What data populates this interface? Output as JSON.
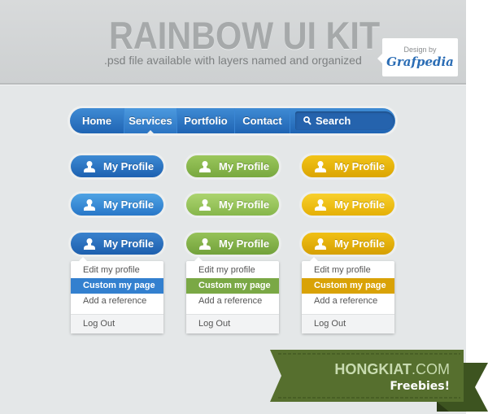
{
  "header": {
    "title": "RAINBOW UI KIT",
    "subtitle": ".psd file available with layers named and organized",
    "badge_by": "Design by",
    "badge_brand": "Grafpedia"
  },
  "nav": {
    "items": [
      {
        "label": "Home",
        "active": false
      },
      {
        "label": "Services",
        "active": true
      },
      {
        "label": "Portfolio",
        "active": false
      },
      {
        "label": "Contact",
        "active": false
      }
    ],
    "search_label": "Search",
    "search_icon": "search-icon"
  },
  "colors": {
    "blue": "#2a72c2",
    "green": "#82b04a",
    "yellow": "#e2ac06",
    "blue_sel": "#3380cf",
    "green_sel": "#7aa845",
    "yellow_sel": "#d9a207",
    "ribbon": "#4f6b2c"
  },
  "profile_button": {
    "label": "My Profile",
    "icon": "user-icon"
  },
  "columns": [
    {
      "name": "blue",
      "states": [
        "normal",
        "hover",
        "pressed"
      ]
    },
    {
      "name": "green",
      "states": [
        "normal",
        "hover",
        "pressed"
      ]
    },
    {
      "name": "yellow",
      "states": [
        "normal",
        "hover",
        "pressed"
      ]
    }
  ],
  "dropdown": {
    "items": [
      "Edit my profile",
      "Custom my page",
      "Add a reference"
    ],
    "selected_index": 1,
    "logout": "Log Out"
  },
  "ribbon": {
    "site": "HONGKIAT",
    "tld": ".COM",
    "tagline": "Freebies!"
  }
}
